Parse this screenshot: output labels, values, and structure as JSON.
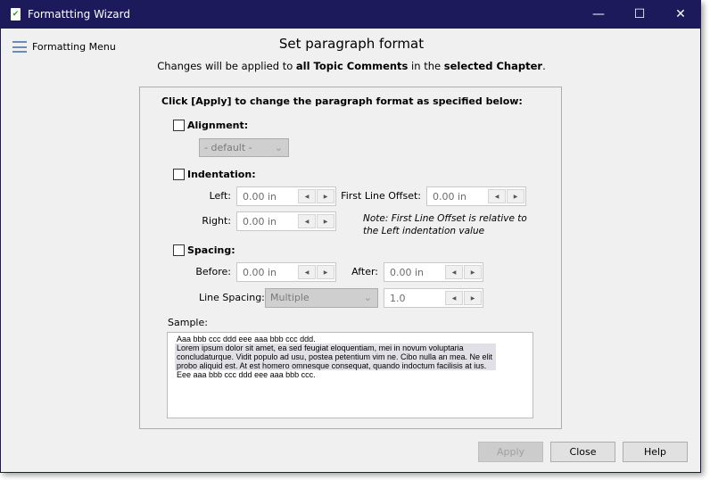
{
  "window": {
    "title": "Formattting Wizard",
    "minimize": "—",
    "maximize": "☐",
    "close": "✕"
  },
  "menu": {
    "label": "Formatting Menu",
    "icon": "hamburger-icon"
  },
  "header": {
    "title": "Set paragraph format",
    "sub_pre": "Changes will be applied to ",
    "sub_b1": "all Topic Comments",
    "sub_mid": " in the ",
    "sub_b2": "selected Chapter",
    "sub_end": "."
  },
  "group": {
    "instruction": "Click [Apply] to change the paragraph format as specified below:"
  },
  "alignment": {
    "label": "Alignment:",
    "checked": false,
    "value": "- default -"
  },
  "indentation": {
    "label": "Indentation:",
    "checked": false,
    "left_label": "Left:",
    "left": "0.00 in",
    "right_label": "Right:",
    "right": "0.00 in",
    "first_label": "First Line Offset:",
    "first": "0.00 in",
    "note1": "Note: First Line Offset is relative to",
    "note2": "the Left indentation value"
  },
  "spacing": {
    "label": "Spacing:",
    "checked": false,
    "before_label": "Before:",
    "before": "0.00 in",
    "after_label": "After:",
    "after": "0.00 in",
    "line_label": "Line Spacing:",
    "line_mode": "Multiple",
    "line_value": "1.0"
  },
  "sample": {
    "label": "Sample:",
    "line1": "Aaa bbb ccc ddd eee aaa bbb ccc ddd.",
    "para": "Lorem ipsum dolor sit amet, ea sed feugiat eloquentiam, mei in novum voluptaria concludaturque. Vidit populo ad usu, postea petentium vim ne. Cibo nulla an mea. Ne elit probo aliquid est. At est homero omnesque consequat, quando indoctum facilisis at ius.",
    "line3": "Eee aaa bbb ccc ddd eee aaa bbb ccc."
  },
  "buttons": {
    "apply": "Apply",
    "close": "Close",
    "help": "Help"
  },
  "colors": {
    "titlebar": "#1c1a5a",
    "background": "#f0f0f0"
  }
}
